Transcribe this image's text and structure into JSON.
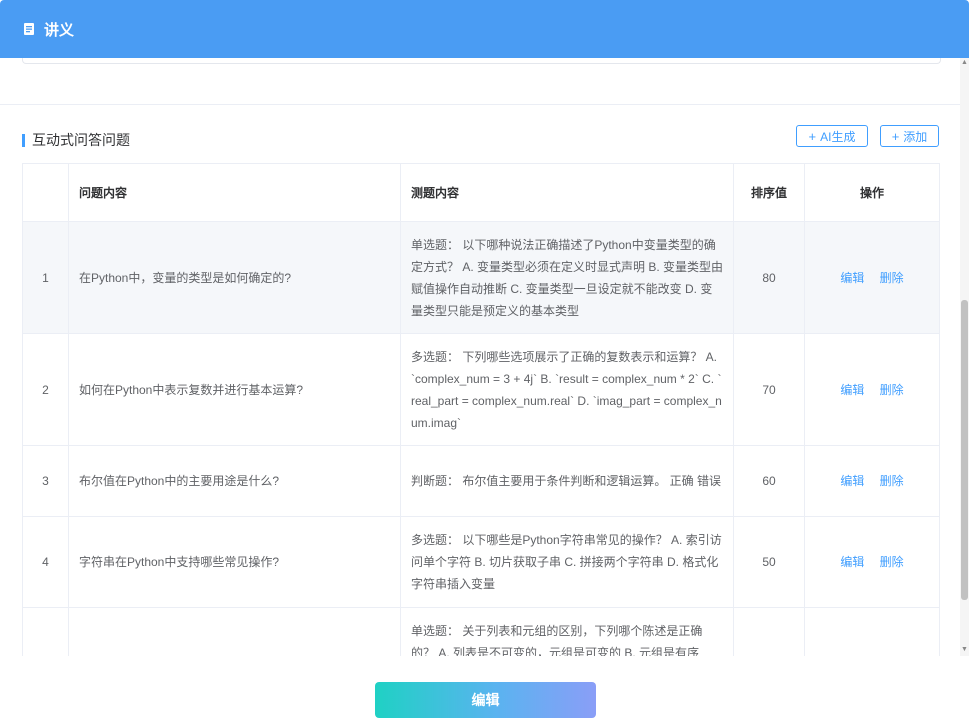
{
  "header": {
    "title": "讲义",
    "icon": "document-icon"
  },
  "section": {
    "title": "互动式问答问题"
  },
  "buttons": {
    "ai_generate": "AI生成",
    "add": "添加",
    "edit_footer": "编辑"
  },
  "table": {
    "columns": [
      "",
      "问题内容",
      "测题内容",
      "排序值",
      "操作"
    ],
    "rows": [
      {
        "index": "1",
        "question": "在Python中，变量的类型是如何确定的?",
        "quiz": "单选题： 以下哪种说法正确描述了Python中变量类型的确定方式？ A. 变量类型必须在定义时显式声明 B. 变量类型由赋值操作自动推断 C. 变量类型一旦设定就不能改变 D. 变量类型只能是预定义的基本类型",
        "sort": "80",
        "edit": "编辑",
        "delete": "删除"
      },
      {
        "index": "2",
        "question": "如何在Python中表示复数并进行基本运算?",
        "quiz": "多选题： 下列哪些选项展示了正确的复数表示和运算？ A. `complex_num = 3 + 4j` B. `result = complex_num * 2` C. `real_part = complex_num.real` D. `imag_part = complex_num.imag`",
        "sort": "70",
        "edit": "编辑",
        "delete": "删除"
      },
      {
        "index": "3",
        "question": "布尔值在Python中的主要用途是什么?",
        "quiz": "判断题： 布尔值主要用于条件判断和逻辑运算。 正确 错误",
        "sort": "60",
        "edit": "编辑",
        "delete": "删除"
      },
      {
        "index": "4",
        "question": "字符串在Python中支持哪些常见操作?",
        "quiz": "多选题： 以下哪些是Python字符串常见的操作？ A. 索引访问单个字符 B. 切片获取子串 C. 拼接两个字符串 D. 格式化字符串插入变量",
        "sort": "50",
        "edit": "编辑",
        "delete": "删除"
      },
      {
        "index": "",
        "question": "",
        "quiz": "单选题： 关于列表和元组的区别，下列哪个陈述是正确的？ A. 列表是不可变的，元组是可变的 B. 元组是有序",
        "sort": "",
        "edit": "",
        "delete": ""
      }
    ]
  },
  "colors": {
    "header": "#4a9cf3",
    "accent": "#409eff"
  }
}
